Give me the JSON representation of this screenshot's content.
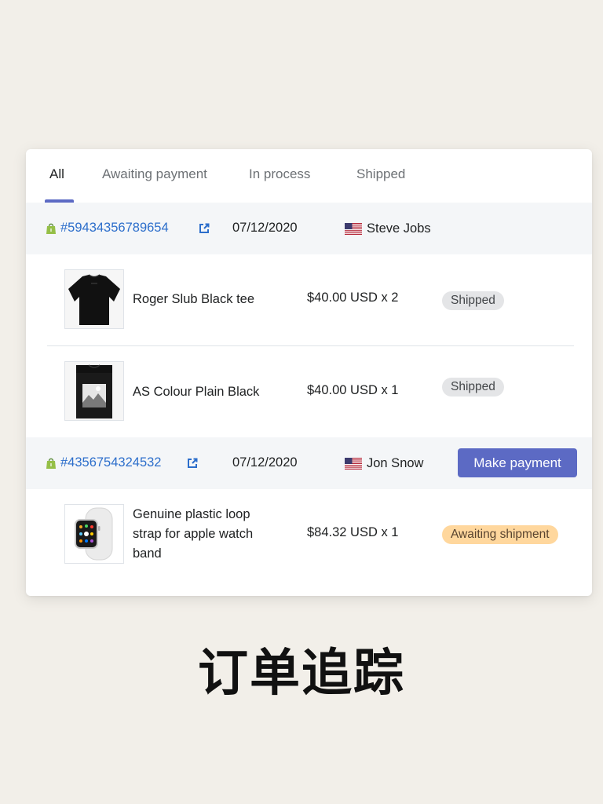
{
  "tabs": [
    {
      "label": "All"
    },
    {
      "label": "Awaiting payment"
    },
    {
      "label": "In process"
    },
    {
      "label": "Shipped"
    }
  ],
  "orders": [
    {
      "number": "#59434356789654",
      "date": "07/12/2020",
      "customer": "Steve Jobs",
      "country_flag": "us-flag-icon",
      "items": [
        {
          "name": "Roger Slub Black tee",
          "price": "$40.00 USD x 2",
          "status": "Shipped",
          "thumb_icon": "black-tshirt-image"
        },
        {
          "name": "AS Colour Plain Black",
          "price": "$40.00 USD x 1",
          "status": "Shipped",
          "thumb_icon": "black-tshirt-print-image"
        }
      ]
    },
    {
      "number": "#4356754324532",
      "date": "07/12/2020",
      "customer": "Jon Snow",
      "country_flag": "us-flag-icon",
      "action_label": "Make payment",
      "items": [
        {
          "name": "Genuine plastic loop strap for apple watch band",
          "price": "$84.32 USD x 1",
          "status": "Awaiting shipment",
          "thumb_icon": "apple-watch-image"
        }
      ]
    }
  ],
  "footer_title": "订单追踪",
  "colors": {
    "accent": "#5c6ac4",
    "link": "#2c6ecb",
    "shopify_green": "#95bf47",
    "shipped_badge": "#e4e5e7",
    "awaiting_badge": "#ffd79d",
    "page_background": "#f2efe9"
  }
}
